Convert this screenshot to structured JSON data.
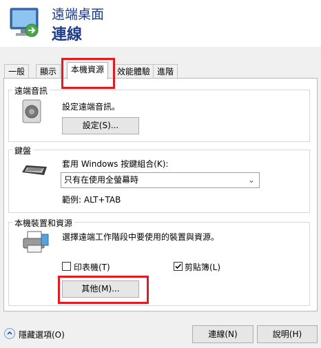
{
  "header": {
    "title": "遠端桌面",
    "subtitle": "連線"
  },
  "tabs": [
    {
      "label": "一般"
    },
    {
      "label": "顯示"
    },
    {
      "label": "本機資源"
    },
    {
      "label": "效能體驗"
    },
    {
      "label": "進階"
    }
  ],
  "audio": {
    "group_label": "遠端音訊",
    "description": "設定遠端音訊。",
    "settings_button": "設定(S)..."
  },
  "keyboard": {
    "group_label": "鍵盤",
    "description": "套用 Windows 按鍵組合(K):",
    "selected": "只有在使用全螢幕時",
    "example": "範例: ALT+TAB"
  },
  "devices": {
    "group_label": "本機裝置和資源",
    "description": "選擇遠端工作階段中要使用的裝置與資源。",
    "printers_label": "印表機(T)",
    "printers_checked": false,
    "clipboard_label": "剪貼簿(L)",
    "clipboard_checked": true,
    "more_button": "其他(M)..."
  },
  "footer": {
    "hide_options": "隱藏選項(O)",
    "connect_button": "連線(N)",
    "help_button": "說明(H)"
  },
  "colors": {
    "title": "#1d3b8c",
    "highlight": "#e01b24"
  }
}
